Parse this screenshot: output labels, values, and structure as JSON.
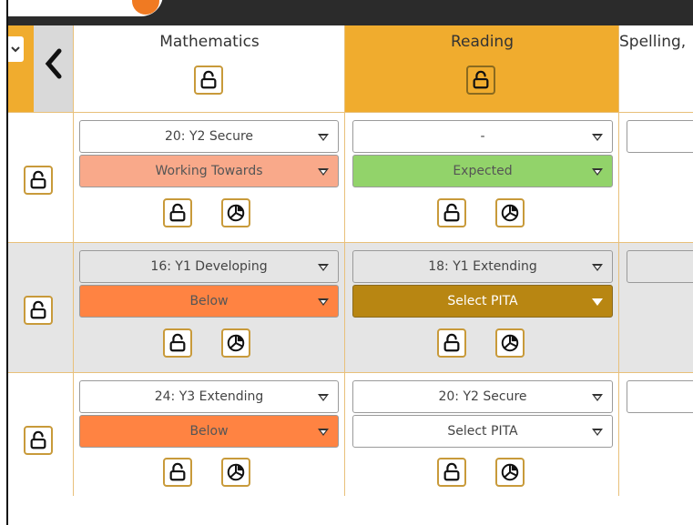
{
  "columns": [
    {
      "name": "Mathematics"
    },
    {
      "name": "Reading"
    },
    {
      "name": "Spelling,"
    }
  ],
  "rows": [
    {
      "cells": [
        {
          "score": "20: Y2 Secure",
          "pita": "Working Towards"
        },
        {
          "score": "-",
          "pita": "Expected"
        }
      ]
    },
    {
      "cells": [
        {
          "score": "16: Y1 Developing",
          "pita": "Below"
        },
        {
          "score": "18: Y1 Extending",
          "pita": "Select PITA"
        }
      ]
    },
    {
      "cells": [
        {
          "score": "24: Y3 Extending",
          "pita": "Below"
        },
        {
          "score": "20: Y2 Secure",
          "pita": "Select PITA"
        }
      ]
    }
  ],
  "colors": {
    "accent": "#f0ac2e",
    "working_towards": "#f9a98a",
    "expected": "#92d36a",
    "below": "#ff8342",
    "select_pita_active": "#b88612",
    "row_alt": "#e5e5e5"
  }
}
